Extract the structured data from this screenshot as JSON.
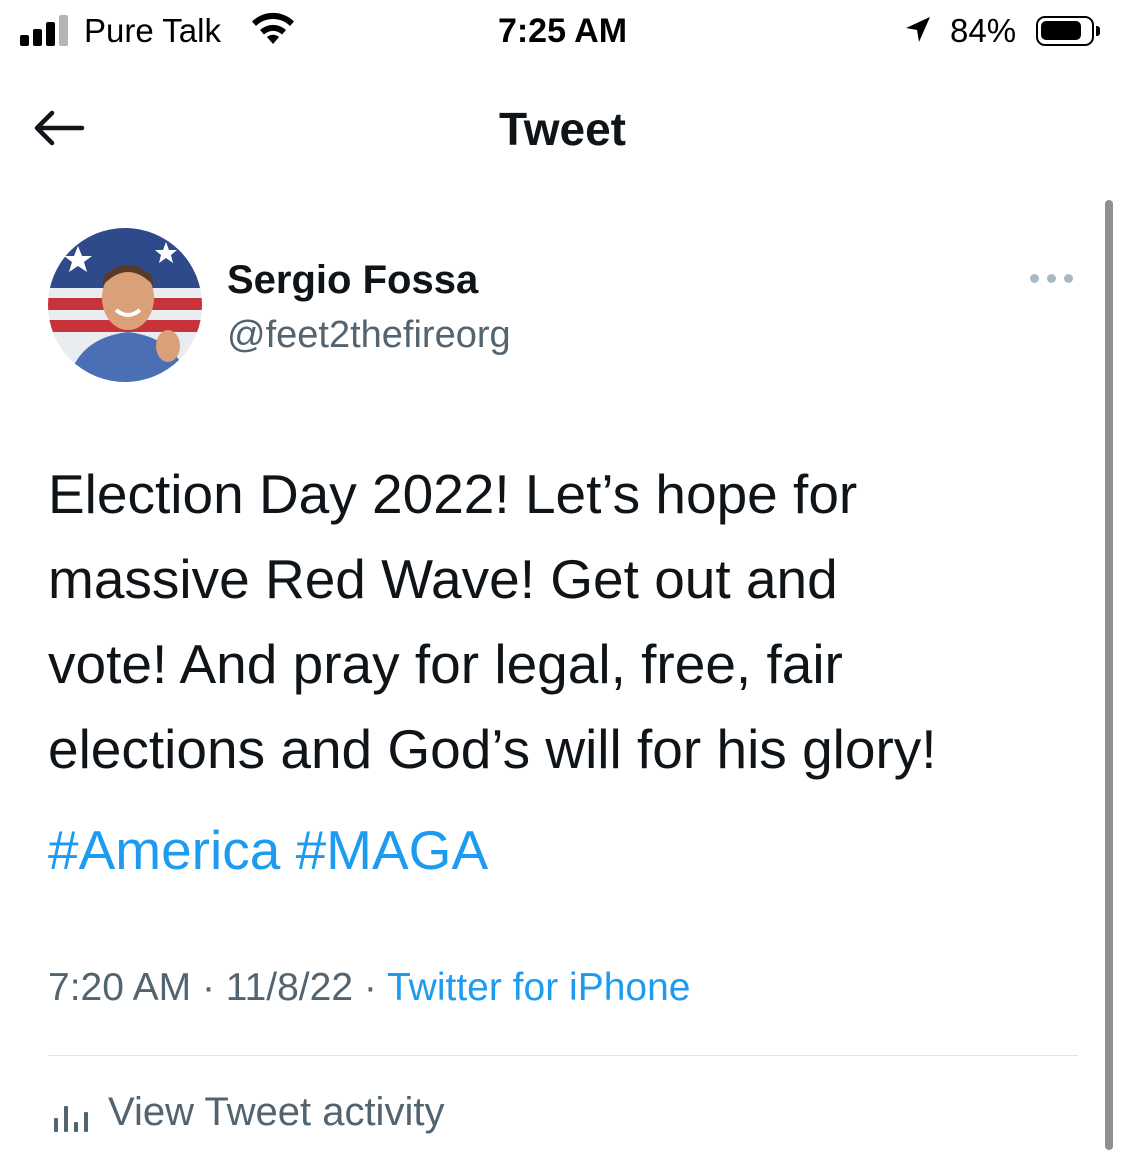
{
  "status_bar": {
    "carrier": "Pure Talk",
    "time": "7:25 AM",
    "battery": "84%",
    "battery_level": 0.84,
    "icons": [
      "signal-bars-icon",
      "wifi-icon",
      "location-arrow-icon",
      "battery-icon"
    ]
  },
  "nav": {
    "back_icon": "arrow-left-icon",
    "title": "Tweet"
  },
  "tweet": {
    "author_name": "Sergio Fossa",
    "author_handle": "@feet2thefireorg",
    "avatar": "profile-photo",
    "more_icon": "more-horizontal-icon",
    "text_lines": [
      "Election Day 2022! Let’s hope for",
      "massive Red Wave! Get out and",
      "vote! And pray for legal, free, fair",
      "elections and God’s will for his glory!"
    ],
    "hashtags": [
      "#America",
      "#MAGA"
    ],
    "time": "7:20 AM",
    "separator": "·",
    "date": "11/8/22",
    "source": "Twitter for iPhone"
  },
  "activity": {
    "icon": "bar-chart-icon",
    "label": "View Tweet activity"
  },
  "colors": {
    "accent": "#1d9bf0",
    "text_primary": "#0f1419",
    "text_secondary": "#536471"
  }
}
